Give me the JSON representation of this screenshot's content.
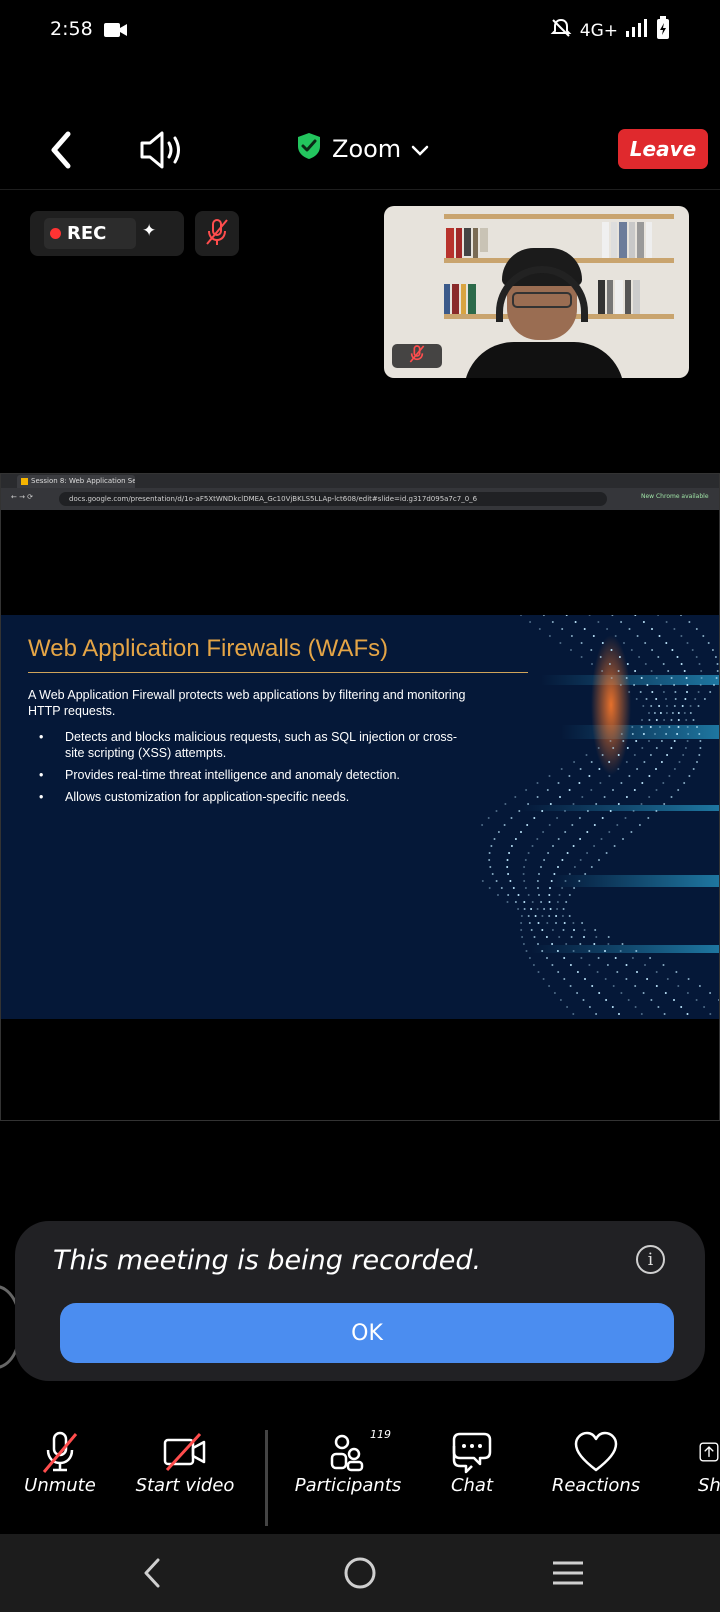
{
  "status_bar": {
    "time": "2:58",
    "network": "4G+",
    "icons": [
      "video-camera-icon",
      "mute-bell-icon",
      "signal-icon",
      "battery-icon"
    ]
  },
  "header": {
    "title": "Zoom",
    "leave_label": "Leave",
    "security_color": "#23c55e",
    "leave_color": "#e0292d"
  },
  "recording": {
    "rec_label": "REC"
  },
  "shared_screen": {
    "browser": {
      "tab_title": "Session 8: Web Application Se...",
      "url": "docs.google.com/presentation/d/1o-aF5XtWNDkclDMEA_Gc10VjBKLS5LLAp-lct608/edit#slide=id.g317d095a7c7_0_6",
      "new_chrome": "New Chrome available"
    },
    "slide": {
      "title": "Web Application Firewalls (WAFs)",
      "intro": "A Web Application Firewall protects web applications by filtering and monitoring HTTP requests.",
      "bullets": [
        "Detects and blocks malicious requests, such as SQL injection or cross-site scripting (XSS) attempts.",
        "Provides real-time threat intelligence and anomaly detection.",
        "Allows customization for application-specific needs."
      ],
      "title_color": "#e5a546",
      "background_color": "#051838"
    }
  },
  "dialog": {
    "message": "This meeting is being recorded.",
    "ok_label": "OK",
    "ok_color": "#4b8df0"
  },
  "toolbar": {
    "unmute_label": "Unmute",
    "start_video_label": "Start video",
    "participants_label": "Participants",
    "participants_count": "119",
    "chat_label": "Chat",
    "reactions_label": "Reactions",
    "share_label": "Sh"
  }
}
